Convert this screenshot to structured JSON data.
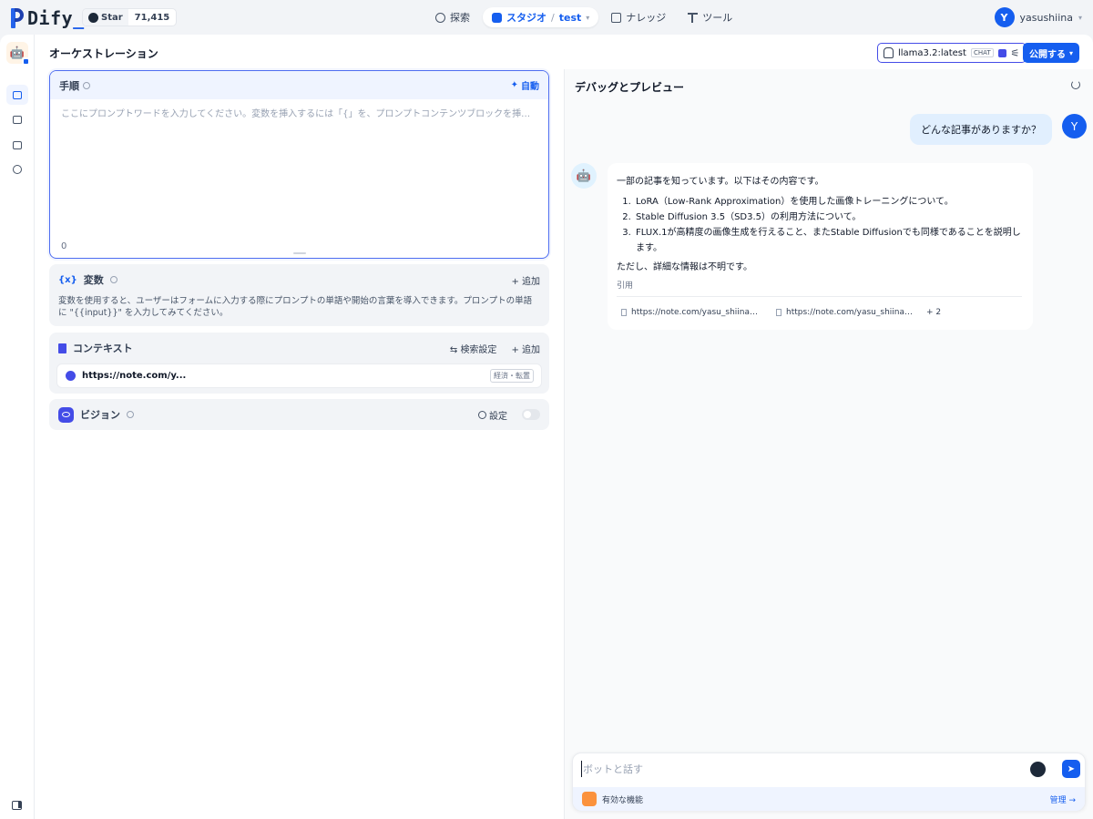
{
  "brand": {
    "name": "Dify",
    "underscore": "_"
  },
  "github": {
    "label": "Star",
    "count": "71,415"
  },
  "nav": {
    "explore": "探索",
    "studio": "スタジオ",
    "studio_sep": "/",
    "app": "test",
    "knowledge": "ナレッジ",
    "tools": "ツール"
  },
  "user": {
    "initial": "Y",
    "name": "yasushiina"
  },
  "page": {
    "title": "オーケストレーション"
  },
  "model": {
    "name": "llama3.2:latest",
    "mode": "CHAT"
  },
  "publish": {
    "label": "公開する"
  },
  "prompt": {
    "label": "手順",
    "auto_label": "自動",
    "placeholder": "ここにプロンプトワードを入力してください。変数を挿入するには「{」を、プロンプトコンテンツブロックを挿入するには「/」を入力します。",
    "count": "0"
  },
  "variables": {
    "icon": "{x}",
    "label": "変数",
    "add": "+ 追加",
    "description": "変数を使用すると、ユーザーはフォームに入力する際にプロンプトの単語や開始の言葉を導入できます。プロンプトの単語に \"{{input}}\" を入力してみてください。"
  },
  "context": {
    "label": "コンテキスト",
    "search_settings": "検索設定",
    "add": "+ 追加",
    "item_name": "https://note.com/y...",
    "item_badge": "経済・転置"
  },
  "vision": {
    "label": "ビジョン",
    "settings": "設定"
  },
  "debug": {
    "title": "デバッグとプレビュー",
    "user_message": "どんな記事がありますか？",
    "bot_intro": "一部の記事を知っています。以下はその内容です。",
    "bot_items": [
      "LoRA（Low-Rank Approximation）を使用した画像トレーニングについて。",
      "Stable Diffusion 3.5（SD3.5）の利用方法について。",
      "FLUX.1が高精度の画像生成を行えること、またStable Diffusionでも同様であることを説明します。"
    ],
    "bot_outro": "ただし、詳細な情報は不明です。",
    "citation_label": "引用",
    "citations": [
      "https://note.com/yasu_shiina/n/ne...",
      "https://note.com/yasu_shiina/n/nf..."
    ],
    "more_citations": "+ 2"
  },
  "chat_input": {
    "placeholder": "ボットと話す"
  },
  "features": {
    "label": "有効な機能",
    "manage": "管理 →"
  },
  "colors": {
    "accent": "#155eef",
    "indigo": "#444ce7"
  }
}
